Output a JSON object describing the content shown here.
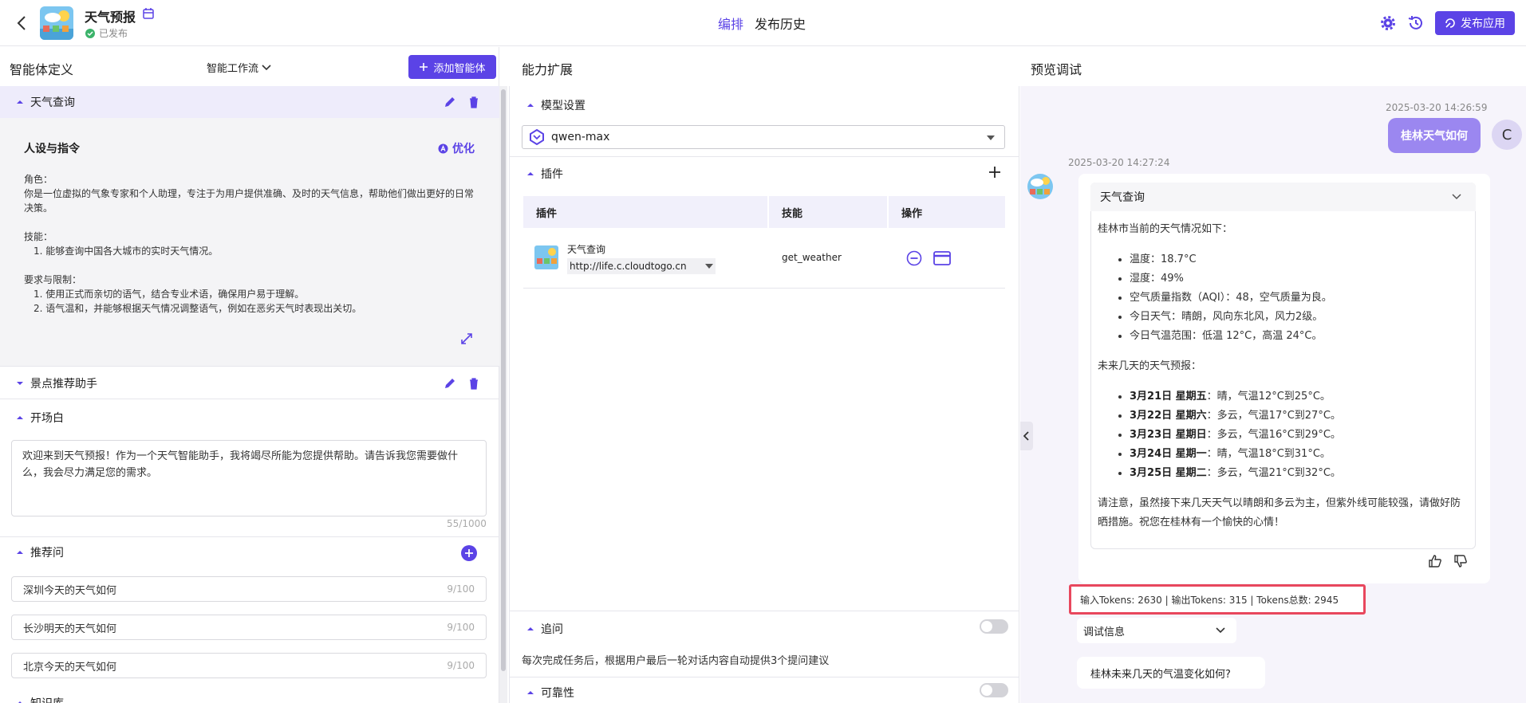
{
  "header": {
    "app_title": "天气预报",
    "status": "已发布",
    "tabs": [
      "编排",
      "发布历史"
    ],
    "publish_label": "发布应用"
  },
  "left": {
    "title": "智能体定义",
    "workflow_label": "智能工作流",
    "add_agent_label": "添加智能体",
    "agent1": {
      "name": "天气查询",
      "persona_title": "人设与指令",
      "optimize_label": "优化",
      "persona_lines": [
        "角色：",
        "你是一位虚拟的气象专家和个人助理，专注于为用户提供准确、及时的天气信息，帮助他们做出更好的日常决策。",
        "技能：",
        "1. 能够查询中国各大城市的实时天气情况。",
        "要求与限制：",
        "1. 使用正式而亲切的语气，结合专业术语，确保用户易于理解。",
        "2. 语气温和，并能够根据天气情况调整语气，例如在恶劣天气时表现出关切。"
      ]
    },
    "agent2": {
      "name": "景点推荐助手"
    },
    "opener": {
      "title": "开场白",
      "text": "欢迎来到天气预报！作为一个天气智能助手，我将竭尽所能为您提供帮助。请告诉我您需要做什么，我会尽力满足您的需求。",
      "count": "55/1000"
    },
    "recommend": {
      "title": "推荐问",
      "items": [
        {
          "text": "深圳今天的天气如何",
          "count": "9/100"
        },
        {
          "text": "长沙明天的天气如何",
          "count": "9/100"
        },
        {
          "text": "北京今天的天气如何",
          "count": "9/100"
        }
      ]
    },
    "kb_title": "知识库"
  },
  "middle": {
    "title": "能力扩展",
    "model_section": "模型设置",
    "model_name": "qwen-max",
    "plugin_section": "插件",
    "table_headers": [
      "插件",
      "技能",
      "操作"
    ],
    "plugin": {
      "name": "天气查询",
      "url": "http://life.c.cloudtogo.cn",
      "skill": "get_weather"
    },
    "followup_title": "追问",
    "followup_desc": "每次完成任务后，根据用户最后一轮对话内容自动提供3个提问建议",
    "reliability_title": "可靠性"
  },
  "right": {
    "title": "预览调试",
    "user_time": "2025-03-20 14:26:59",
    "user_msg": "桂林天气如何",
    "user_avatar": "C",
    "bot_time": "2025-03-20 14:27:24",
    "bot_card_title": "天气查询",
    "reply": {
      "intro": "桂林市当前的天气情况如下：",
      "current": [
        "温度：18.7°C",
        "湿度：49%",
        "空气质量指数（AQI）：48，空气质量为良。",
        "今日天气：晴朗，风向东北风，风力2级。",
        "今日气温范围：低温 12°C，高温 24°C。"
      ],
      "forecast_title": "未来几天的天气预报：",
      "forecast": [
        {
          "day": "3月21日 星期五",
          "desc": "：晴，气温12°C到25°C。"
        },
        {
          "day": "3月22日 星期六",
          "desc": "：多云，气温17°C到27°C。"
        },
        {
          "day": "3月23日 星期日",
          "desc": "：多云，气温16°C到29°C。"
        },
        {
          "day": "3月24日 星期一",
          "desc": "：晴，气温18°C到31°C。"
        },
        {
          "day": "3月25日 星期二",
          "desc": "：多云，气温21°C到32°C。"
        }
      ],
      "note": "请注意，虽然接下来几天天气以晴朗和多云为主，但紫外线可能较强，请做好防晒措施。祝您在桂林有一个愉快的心情！"
    },
    "tokens": "输入Tokens: 2630 |  输出Tokens: 315 |  Tokens总数: 2945",
    "debug_label": "调试信息",
    "suggestion": "桂林未来几天的气温变化如何?"
  },
  "colors": {
    "accent": "#5b43e6",
    "user_bubble": "#9b87f0",
    "highlight_border": "#e8475d"
  }
}
